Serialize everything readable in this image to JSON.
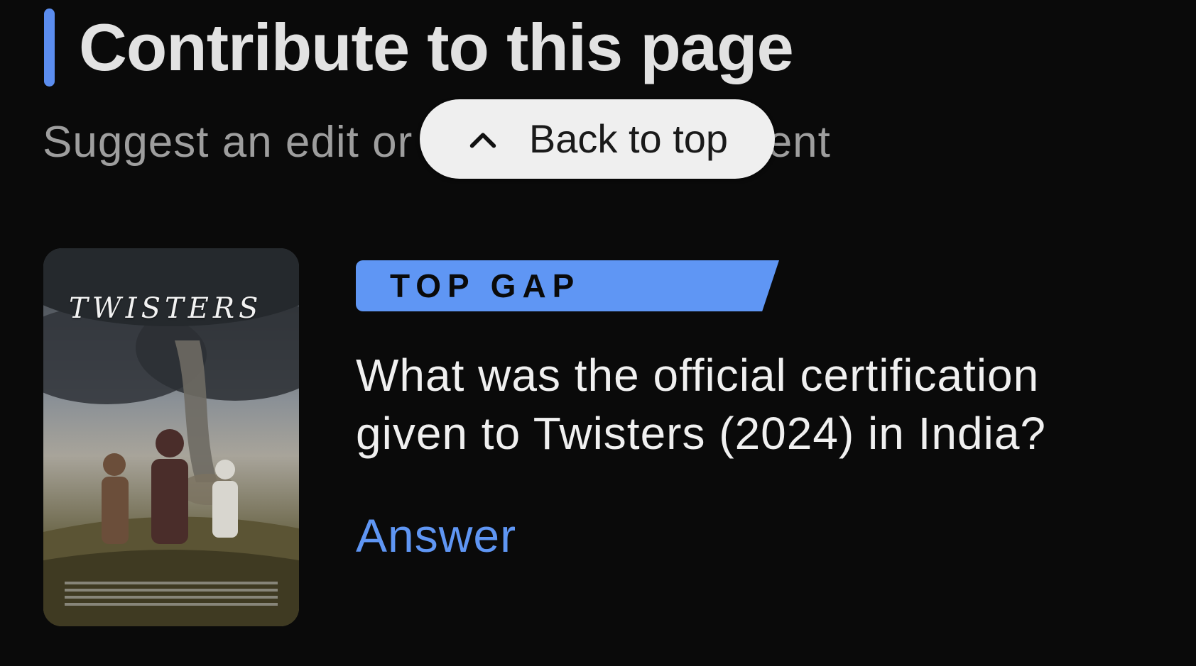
{
  "section": {
    "title": "Contribute to this page",
    "subtitle": "Suggest an edit or add missing content"
  },
  "back_to_top": {
    "label": "Back to top",
    "icon": "chevron-up-icon"
  },
  "poster": {
    "title_text": "TWISTERS",
    "alt": "Twisters poster"
  },
  "gap_card": {
    "badge": "TOP GAP",
    "question": "What was the official certification given to Twisters (2024) in India?",
    "action_label": "Answer"
  },
  "colors": {
    "background": "#0a0a0a",
    "accent": "#5f96f4",
    "title": "#e2e2e2",
    "subtitle": "#9e9e9e",
    "pill": "#efefef"
  }
}
